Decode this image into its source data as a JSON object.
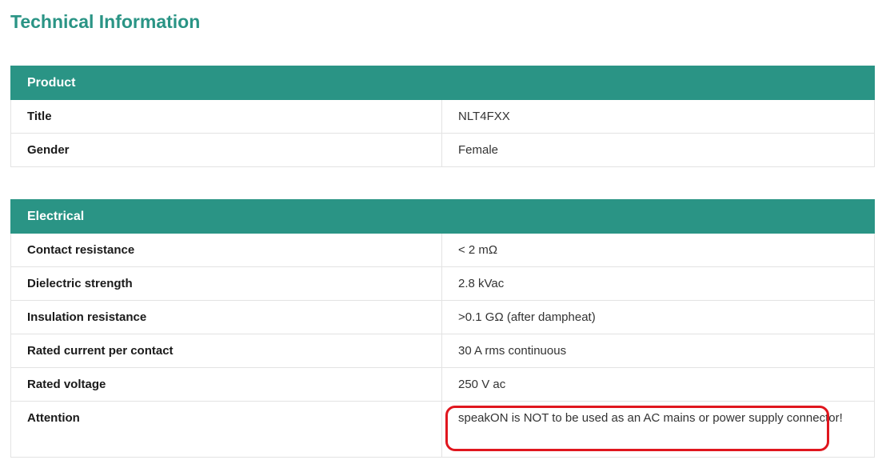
{
  "page": {
    "title": "Technical Information"
  },
  "product": {
    "header": "Product",
    "rows": [
      {
        "label": "Title",
        "value": "NLT4FXX"
      },
      {
        "label": "Gender",
        "value": "Female"
      }
    ]
  },
  "electrical": {
    "header": "Electrical",
    "rows": [
      {
        "label": "Contact resistance",
        "value": "< 2 mΩ"
      },
      {
        "label": "Dielectric strength",
        "value": "2.8 kVac"
      },
      {
        "label": "Insulation resistance",
        "value": ">0.1 GΩ (after dampheat)"
      },
      {
        "label": "Rated current per contact",
        "value": "30 A rms continuous"
      },
      {
        "label": "Rated voltage",
        "value": "250 V ac"
      },
      {
        "label": "Attention",
        "value": "speakON is NOT to be used as an AC mains or power supply connector!"
      }
    ]
  },
  "colors": {
    "accent": "#2a9485",
    "highlight": "#e0161e"
  }
}
